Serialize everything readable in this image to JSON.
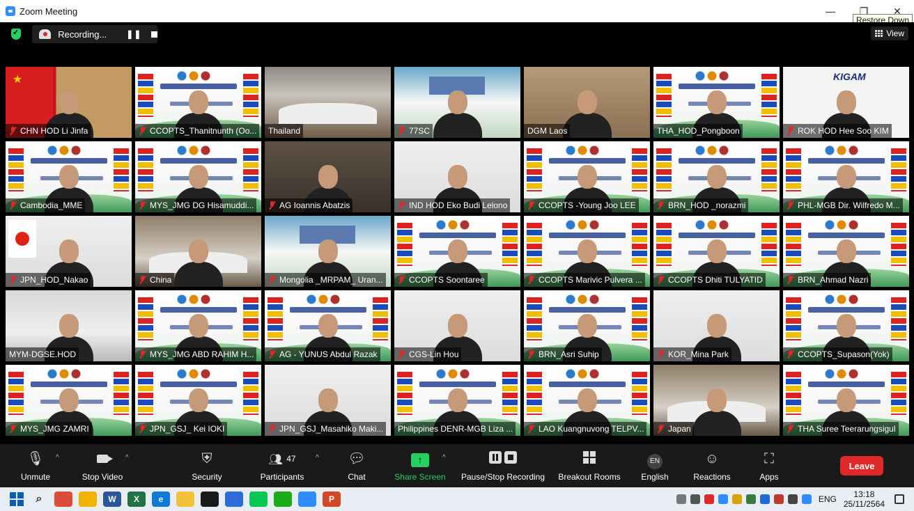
{
  "window": {
    "title": "Zoom Meeting",
    "tooltip": "Restore Down",
    "minimize_glyph": "—",
    "restore_glyph": "❐",
    "close_glyph": "✕"
  },
  "top_bar": {
    "recording_label": "Recording...",
    "pause_glyph": "❚❚",
    "view_label": "View"
  },
  "participants": [
    {
      "name": "CHN HOD Li Jinfa",
      "muted": true,
      "bg": "flagbg"
    },
    {
      "name": "CCOPTS_Thanitnunth (Oo...",
      "muted": true,
      "bg": "slide"
    },
    {
      "name": "Thailand",
      "muted": false,
      "bg": "room",
      "active": true
    },
    {
      "name": "77SC",
      "muted": true,
      "bg": "teal"
    },
    {
      "name": "DGM Laos",
      "muted": false,
      "bg": "brownwall"
    },
    {
      "name": "THA_HOD_Pongboon",
      "muted": false,
      "bg": "slide"
    },
    {
      "name": "ROK HOD Hee Soo KIM",
      "muted": true,
      "bg": "white",
      "logo": "KIGAM"
    },
    {
      "name": "Cambodia_MME",
      "muted": true,
      "bg": "slide"
    },
    {
      "name": "MYS_JMG DG Hisamuddi...",
      "muted": true,
      "bg": "slide"
    },
    {
      "name": "AG Ioannis Abatzis",
      "muted": true,
      "bg": "dark"
    },
    {
      "name": "IND HOD Eko Budi Lelono",
      "muted": true,
      "bg": "whitewall"
    },
    {
      "name": "CCOPTS -Young Joo LEE",
      "muted": true,
      "bg": "slide"
    },
    {
      "name": "BRN_HOD _norazmi",
      "muted": true,
      "bg": "slide"
    },
    {
      "name": "PHL-MGB Dir. Wilfredo M...",
      "muted": true,
      "bg": "slide"
    },
    {
      "name": "JPN_HOD_Nakao",
      "muted": true,
      "bg": "whitewall",
      "jpflag": true
    },
    {
      "name": "China",
      "muted": true,
      "bg": "japanbg"
    },
    {
      "name": "Mongolia _MRPAM_ Uran...",
      "muted": true,
      "bg": "teal"
    },
    {
      "name": "CCOPTS Soontaree",
      "muted": true,
      "bg": "slide"
    },
    {
      "name": "CCOPTS Marivic Pulvera ...",
      "muted": true,
      "bg": "slide"
    },
    {
      "name": "CCOPTS Dhiti TULYATID",
      "muted": true,
      "bg": "slide"
    },
    {
      "name": "BRN_Ahmad Nazri",
      "muted": true,
      "bg": "slide"
    },
    {
      "name": "MYM-DGSE.HOD",
      "muted": false,
      "bg": "office"
    },
    {
      "name": "MYS_JMG ABD RAHIM H...",
      "muted": true,
      "bg": "slide"
    },
    {
      "name": "AG - YUNUS Abdul Razak",
      "muted": true,
      "bg": "slide"
    },
    {
      "name": "CGS-Lin Hou",
      "muted": true,
      "bg": "whitewall"
    },
    {
      "name": "BRN_Asri Suhip",
      "muted": true,
      "bg": "slide"
    },
    {
      "name": "KOR_Mina Park",
      "muted": true,
      "bg": "whitewall"
    },
    {
      "name": "CCOPTS_Supason(Yok)",
      "muted": true,
      "bg": "slide"
    },
    {
      "name": "MYS_JMG ZAMRI",
      "muted": true,
      "bg": "slide"
    },
    {
      "name": "JPN_GSJ_ Kei IOKI",
      "muted": true,
      "bg": "slide"
    },
    {
      "name": "JPN_GSJ_Masahiko Maki...",
      "muted": true,
      "bg": "whitewall"
    },
    {
      "name": "Philippines DENR-MGB Liza ...",
      "muted": false,
      "bg": "slide"
    },
    {
      "name": "LAO Kuangnuvong TELPV...",
      "muted": true,
      "bg": "slide"
    },
    {
      "name": "Japan",
      "muted": true,
      "bg": "japanbg"
    },
    {
      "name": "THA Suree Teerarungsigul",
      "muted": true,
      "bg": "slide"
    }
  ],
  "toolbar": {
    "unmute": "Unmute",
    "stop_video": "Stop Video",
    "security": "Security",
    "participants": "Participants",
    "participants_count": "47",
    "chat": "Chat",
    "share_screen": "Share Screen",
    "pause_stop_recording": "Pause/Stop Recording",
    "breakout_rooms": "Breakout Rooms",
    "language_badge": "EN",
    "english": "English",
    "reactions": "Reactions",
    "apps": "Apps",
    "leave": "Leave",
    "caret": "^"
  },
  "taskbar": {
    "lang": "ENG",
    "time": "13:18",
    "date": "25/11/2564",
    "apps": [
      {
        "icon": "chrome-icon",
        "color": "#dd4b39"
      },
      {
        "icon": "folder-icon",
        "color": "#f0b400"
      },
      {
        "icon": "word-icon",
        "color": "#2b579a",
        "glyph": "W"
      },
      {
        "icon": "excel-icon",
        "color": "#217346",
        "glyph": "X"
      },
      {
        "icon": "edge-icon",
        "color": "#0e7ad6",
        "glyph": "e"
      },
      {
        "icon": "explorer-icon",
        "color": "#f3c13a"
      },
      {
        "icon": "store-icon",
        "color": "#1a1a1a"
      },
      {
        "icon": "media-icon",
        "color": "#2d6bd9"
      },
      {
        "icon": "line-icon",
        "color": "#06c755"
      },
      {
        "icon": "wechat-icon",
        "color": "#1aad19"
      },
      {
        "icon": "zoom-icon",
        "color": "#2d8cff"
      },
      {
        "icon": "powerpoint-icon",
        "color": "#d24726",
        "glyph": "P"
      }
    ]
  }
}
